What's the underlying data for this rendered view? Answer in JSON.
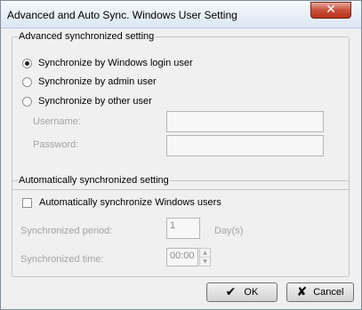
{
  "window": {
    "title": "Advanced and Auto Sync. Windows User Setting",
    "close_glyph": "✕"
  },
  "advanced_group": {
    "title": "Advanced synchronized setting",
    "options": [
      {
        "label": "Synchronize by Windows login user",
        "selected": true
      },
      {
        "label": "Synchronize by admin user",
        "selected": false
      },
      {
        "label": "Synchronize by other user",
        "selected": false
      }
    ],
    "username_label": "Username:",
    "username_value": "",
    "password_label": "Password:",
    "password_value": ""
  },
  "auto_group": {
    "title": "Automatically synchronized setting",
    "checkbox_label": "Automatically synchronize Windows users",
    "checkbox_checked": false,
    "period_label": "Synchronized period:",
    "period_value": "1",
    "period_unit": "Day(s)",
    "time_label": "Synchronized time:",
    "time_value": "00:00"
  },
  "buttons": {
    "ok_label": "OK",
    "ok_icon": "check-icon",
    "cancel_label": "Cancel",
    "cancel_icon": "x-icon"
  }
}
